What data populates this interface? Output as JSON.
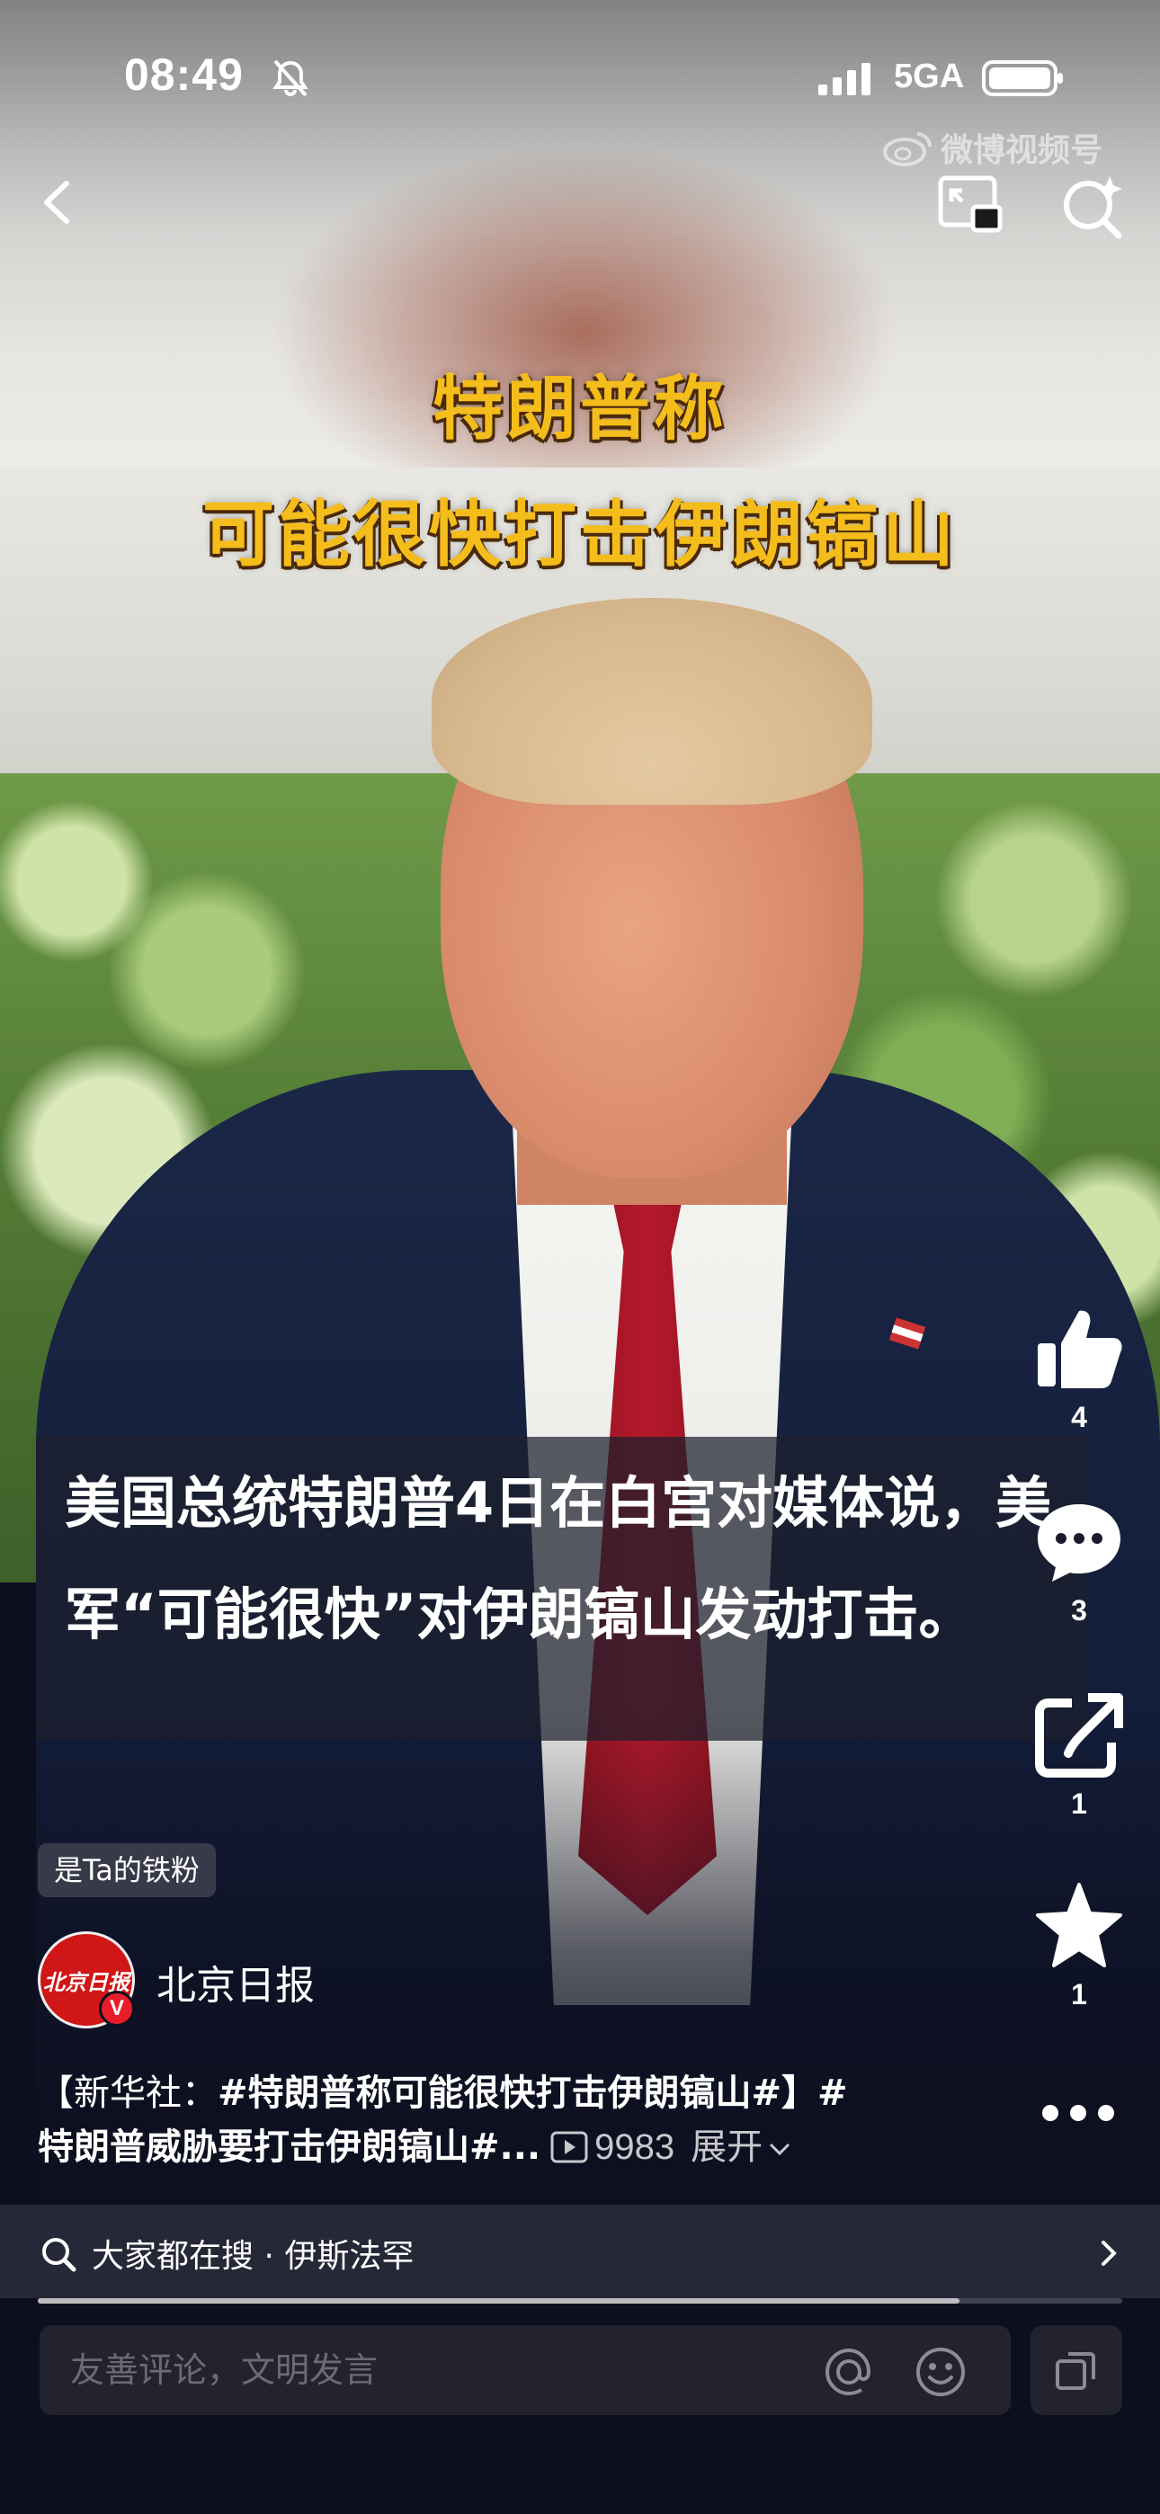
{
  "status_bar": {
    "time": "08:49",
    "network": "5GA"
  },
  "watermark": {
    "text": "微博视频号"
  },
  "video": {
    "headline_line1": "特朗普称",
    "headline_line2": "可能很快打击伊朗镐山",
    "subtitle": "美国总统特朗普4日在白宫对媒体说，美军“可能很快”对伊朗镐山发动打击。"
  },
  "actions": {
    "like_count": "4",
    "comment_count": "3",
    "share_count": "1",
    "favorite_count": "1"
  },
  "author": {
    "fan_badge": "是Ta的铁粉",
    "avatar_text": "北京日报",
    "verified_mark": "V",
    "name": "北京日报"
  },
  "caption": {
    "line1_prefix": "【新华社：",
    "line1_topic": "#特朗普称可能很快打击伊朗镐山#",
    "line1_suffix": "】#",
    "line2_text": "特朗普威胁要打击伊朗镐山#...",
    "play_count": "9983",
    "expand_label": "展开"
  },
  "related_search": {
    "label": "大家都在搜 · 伊斯法罕"
  },
  "playback": {
    "progress_percent": 85
  },
  "comment_box": {
    "placeholder": "友善评论，文明发言"
  },
  "icons": {
    "back": "chevron-left-icon",
    "pip": "picture-in-picture-icon",
    "search": "search-sparkle-icon",
    "like": "thumbs-up-icon",
    "comment": "chat-bubble-icon",
    "share": "share-arrow-icon",
    "favorite": "star-icon",
    "more": "ellipsis-icon"
  },
  "colors": {
    "headline": "#f4bd1c",
    "brand_red": "#d01617",
    "background": "#0d0f1e"
  }
}
